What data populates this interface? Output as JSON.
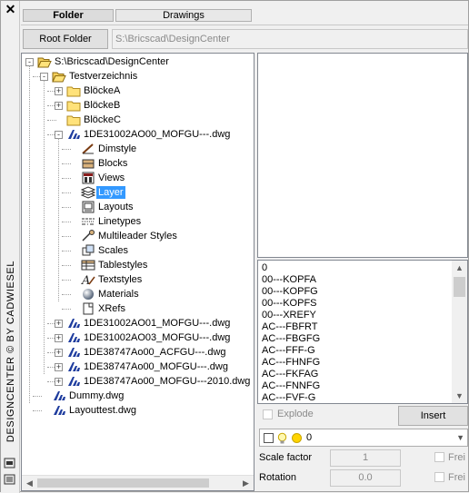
{
  "sidebar": {
    "close_glyph": "✕",
    "title": "DESIGNCENTER   © BY CADWIESEL",
    "icons": [
      "pin-icon",
      "menu-icon"
    ]
  },
  "tabs": [
    {
      "label": "Folder",
      "active": true
    },
    {
      "label": "Drawings",
      "active": false
    }
  ],
  "toolbar": {
    "root_folder_label": "Root Folder",
    "path": "S:\\Bricscad\\DesignCenter"
  },
  "tree": [
    {
      "label": "S:\\Bricscad\\DesignCenter",
      "icon": "folder-open-icon",
      "level": 0,
      "expander": "-"
    },
    {
      "label": "Testverzeichnis",
      "icon": "folder-open-icon",
      "level": 1,
      "expander": "-"
    },
    {
      "label": "BlöckeA",
      "icon": "folder-icon",
      "level": 2,
      "expander": "+"
    },
    {
      "label": "BlöckeB",
      "icon": "folder-icon",
      "level": 2,
      "expander": "+"
    },
    {
      "label": "BlöckeC",
      "icon": "folder-icon",
      "level": 2,
      "expander": ""
    },
    {
      "label": "1DE31002AO00_MOFGU---.dwg",
      "icon": "dwg-icon",
      "level": 2,
      "expander": "-"
    },
    {
      "label": "Dimstyle",
      "icon": "dimstyle-icon",
      "level": 3,
      "expander": ""
    },
    {
      "label": "Blocks",
      "icon": "blocks-icon",
      "level": 3,
      "expander": ""
    },
    {
      "label": "Views",
      "icon": "views-icon",
      "level": 3,
      "expander": ""
    },
    {
      "label": "Layer",
      "icon": "layer-icon",
      "level": 3,
      "expander": "",
      "selected": true
    },
    {
      "label": "Layouts",
      "icon": "layouts-icon",
      "level": 3,
      "expander": ""
    },
    {
      "label": "Linetypes",
      "icon": "linetypes-icon",
      "level": 3,
      "expander": ""
    },
    {
      "label": "Multileader Styles",
      "icon": "multileader-icon",
      "level": 3,
      "expander": ""
    },
    {
      "label": "Scales",
      "icon": "scales-icon",
      "level": 3,
      "expander": ""
    },
    {
      "label": "Tablestyles",
      "icon": "tablestyles-icon",
      "level": 3,
      "expander": ""
    },
    {
      "label": "Textstyles",
      "icon": "textstyles-icon",
      "level": 3,
      "expander": ""
    },
    {
      "label": "Materials",
      "icon": "materials-icon",
      "level": 3,
      "expander": ""
    },
    {
      "label": "XRefs",
      "icon": "xrefs-icon",
      "level": 3,
      "expander": ""
    },
    {
      "label": "1DE31002AO01_MOFGU---.dwg",
      "icon": "dwg-icon",
      "level": 2,
      "expander": "+"
    },
    {
      "label": "1DE31002AO03_MOFGU---.dwg",
      "icon": "dwg-icon",
      "level": 2,
      "expander": "+"
    },
    {
      "label": "1DE38747Ao00_ACFGU---.dwg",
      "icon": "dwg-icon",
      "level": 2,
      "expander": "+"
    },
    {
      "label": "1DE38747Ao00_MOFGU---.dwg",
      "icon": "dwg-icon",
      "level": 2,
      "expander": "+"
    },
    {
      "label": "1DE38747Ao00_MOFGU---2010.dwg",
      "icon": "dwg-icon",
      "level": 2,
      "expander": "+"
    },
    {
      "label": "Dummy.dwg",
      "icon": "dwg-icon",
      "level": 1,
      "expander": ""
    },
    {
      "label": "Layouttest.dwg",
      "icon": "dwg-icon",
      "level": 1,
      "expander": ""
    }
  ],
  "list": [
    "0",
    "00---KOPFA",
    "00---KOPFG",
    "00---KOPFS",
    "00---XREFY",
    "AC---FBFRT",
    "AC---FBGFG",
    "AC---FFF-G",
    "AC---FHNFG",
    "AC---FKFAG",
    "AC---FNNFG",
    "AC---FVF-G"
  ],
  "options": {
    "explode_label": "Explode",
    "insert_label": "Insert",
    "layer_value": "0",
    "scale_label": "Scale factor",
    "scale_value": "1",
    "rotation_label": "Rotation",
    "rotation_value": "0.0",
    "free_label": "Frei"
  },
  "colors": {
    "selection": "#3399ff",
    "dwg_blue": "#1e3c9e",
    "folder_yellow": "#ffe27a"
  }
}
